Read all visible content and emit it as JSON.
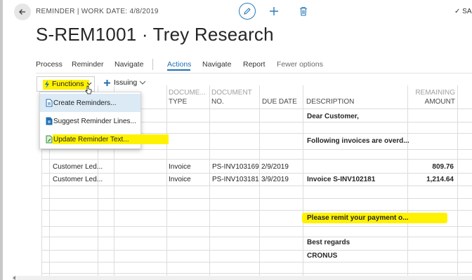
{
  "header": {
    "caption": "REMINDER | WORK DATE: 4/8/2019",
    "title": "S-REM1001 · Trey Research",
    "save_status": "✓ SA"
  },
  "menubar": {
    "items": [
      "Process",
      "Reminder",
      "Navigate",
      "Actions",
      "Navigate",
      "Report",
      "Fewer options"
    ],
    "active": "Actions"
  },
  "actionbar": {
    "functions_label": "Functions",
    "issuing_label": "Issuing"
  },
  "dropdown": {
    "items": [
      "Create Reminders...",
      "Suggest Reminder Lines...",
      "Update Reminder Text..."
    ]
  },
  "table": {
    "headers": {
      "doc_type_top": "Docume...",
      "doc_type": "Type",
      "doc_no_top": "Document",
      "doc_no": "No.",
      "due_date": "Due Date",
      "description": "Description",
      "remaining_top": "Remaining",
      "remaining": "Amount"
    },
    "rows": {
      "r1_desc": "Dear Customer,",
      "r3_desc": "Following invoices are overd...",
      "r6_type": "Customer Led...",
      "r6_doctype": "Invoice",
      "r6_docno": "PS-INV103169",
      "r6_due": "2/9/2019",
      "r6_amount": "809.76",
      "r7_type": "Customer Led...",
      "r7_doctype": "Invoice",
      "r7_docno": "PS-INV103181",
      "r7_due": "3/9/2019",
      "r7_desc": "Invoice S-INV102181",
      "r7_amount": "1,214.64",
      "r10_desc": "Please remit your payment o...",
      "r12_desc": "Best regards",
      "r13_desc": "CRONUS"
    }
  },
  "colors": {
    "accent": "#1f6fb2",
    "highlight": "#fff200"
  }
}
